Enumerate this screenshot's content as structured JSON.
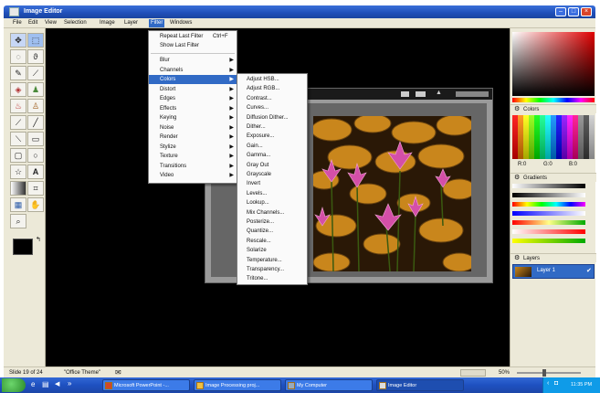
{
  "window": {
    "title": "Image Editor"
  },
  "menubar": [
    "File",
    "Edit",
    "View",
    "Selection",
    "Image",
    "Layer",
    "Filter",
    "Windows"
  ],
  "filter_menu": {
    "top_items": [
      {
        "label": "Repeat Last Filter",
        "shortcut": "Ctrl+F"
      },
      {
        "label": "Show Last Filter",
        "shortcut": ""
      }
    ],
    "items": [
      "Blur",
      "Channels",
      "Colors",
      "Distort",
      "Edges",
      "Effects",
      "Keying",
      "Noise",
      "Render",
      "Stylize",
      "Texture",
      "Transitions",
      "Video"
    ],
    "highlighted": "Colors"
  },
  "colors_submenu": [
    "Adjust HSB...",
    "Adjust RGB...",
    "Contrast...",
    "Curves...",
    "Diffusion Dither...",
    "Dither...",
    "Exposure...",
    "Gain...",
    "Gamma...",
    "Gray Out",
    "Grayscale",
    "Invert",
    "Levels...",
    "Lookup...",
    "Mix Channels...",
    "Posterize...",
    "Quantize...",
    "Rescale...",
    "Solarize",
    "Temperature...",
    "Transparency...",
    "Tritone..."
  ],
  "right_panel": {
    "colors_title": "Colors",
    "color_values": [
      "R:0",
      "G:0",
      "B:0"
    ],
    "gradients_title": "Gradients",
    "layers_title": "Layers",
    "layer_name": "Layer 1"
  },
  "statusbar": {
    "slide": "Slide 19 of 24",
    "theme": "\"Office Theme\"",
    "zoom": "50%"
  },
  "taskbar": {
    "tasks": [
      "Microsoft PowerPoint -...",
      "Image Processing proj...",
      "My Computer",
      "Image Editor"
    ],
    "clock": "11:35 PM"
  },
  "icons": {
    "tools": [
      "move-icon",
      "select-rect-icon",
      "select-ellipse-icon",
      "lasso-icon",
      "pencil-icon",
      "brush-icon",
      "eraser-icon",
      "stamp-icon",
      "fill-icon",
      "dropper-icon",
      "smudge-icon",
      "line-icon",
      "rect-shape-icon",
      "rounded-rect-icon",
      "ellipse-shape-icon",
      "polygon-icon",
      "star-icon",
      "text-icon",
      "gradient-icon",
      "crop-icon",
      "grid-icon",
      "hand-icon",
      "zoom-icon"
    ]
  },
  "colors": {
    "foreground": "#000000",
    "background": "#ffffff",
    "highlight": "#316ac5"
  }
}
